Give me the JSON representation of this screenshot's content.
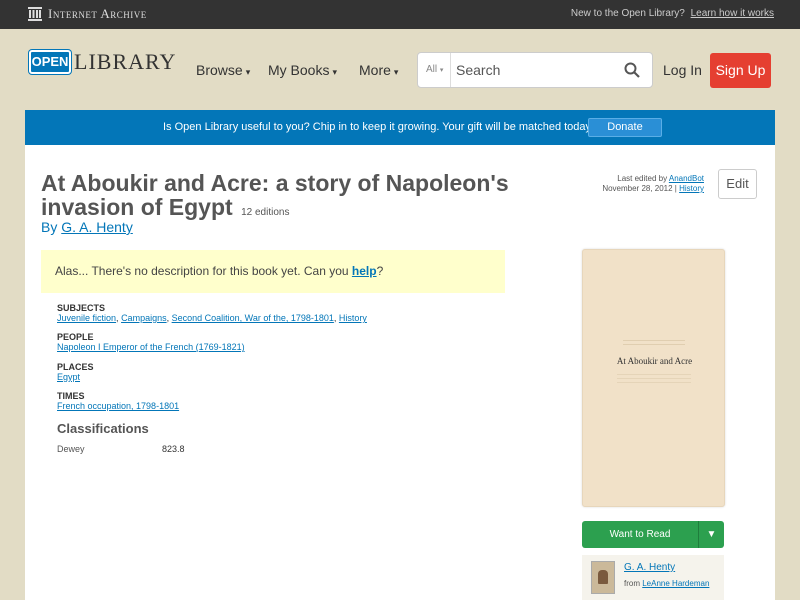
{
  "ia_bar": {
    "logo_text": "Internet Archive",
    "new_text": "New to the Open Library?",
    "learn_link": "Learn how it works"
  },
  "header": {
    "logo_open": "OPEN",
    "logo_library": "LIBRARY",
    "nav": [
      {
        "label": "Browse"
      },
      {
        "label": "My Books"
      },
      {
        "label": "More"
      }
    ],
    "search": {
      "scope": "All",
      "placeholder": "Search"
    },
    "login_label": "Log In",
    "signup_label": "Sign Up"
  },
  "donate_banner": {
    "message": "Is Open Library useful to you? Chip in to keep it growing. Your gift will be matched today!",
    "button_label": "Donate"
  },
  "book": {
    "title": "At Aboukir and Acre: a story of Napoleon's invasion of Egypt",
    "editions": "12 editions",
    "by_label": "By",
    "author": "G. A. Henty",
    "last_edited_label": "Last edited by",
    "last_edited_by": "AnandBot",
    "last_edited_date": "November 28, 2012",
    "history_link": "History",
    "edit_label": "Edit",
    "description_text": "Alas... There's no description for this book yet. Can you",
    "description_help": "help",
    "description_tail": "?"
  },
  "facets": {
    "subjects": {
      "header": "Subjects",
      "items": [
        "Juvenile fiction",
        "Campaigns",
        "Second Coalition, War of the, 1798-1801",
        "History"
      ]
    },
    "people": {
      "header": "People",
      "items": [
        "Napoleon I Emperor of the French (1769-1821)"
      ]
    },
    "places": {
      "header": "Places",
      "items": [
        "Egypt"
      ]
    },
    "times": {
      "header": "Times",
      "items": [
        "French occupation, 1798-1801"
      ]
    }
  },
  "classifications": {
    "header": "Classifications",
    "dewey_label": "Dewey",
    "dewey_value": "823.8"
  },
  "sidebar": {
    "cover_title": "At Aboukir and Acre",
    "want_to_read": "Want to Read",
    "author_name": "G. A. Henty",
    "from_label": "from",
    "from_user": "LeAnne Hardeman"
  },
  "colors": {
    "accent_blue": "#0376b8",
    "signup_red": "#e53f31",
    "want_green": "#2ca04f",
    "background": "#e2dcc5"
  }
}
